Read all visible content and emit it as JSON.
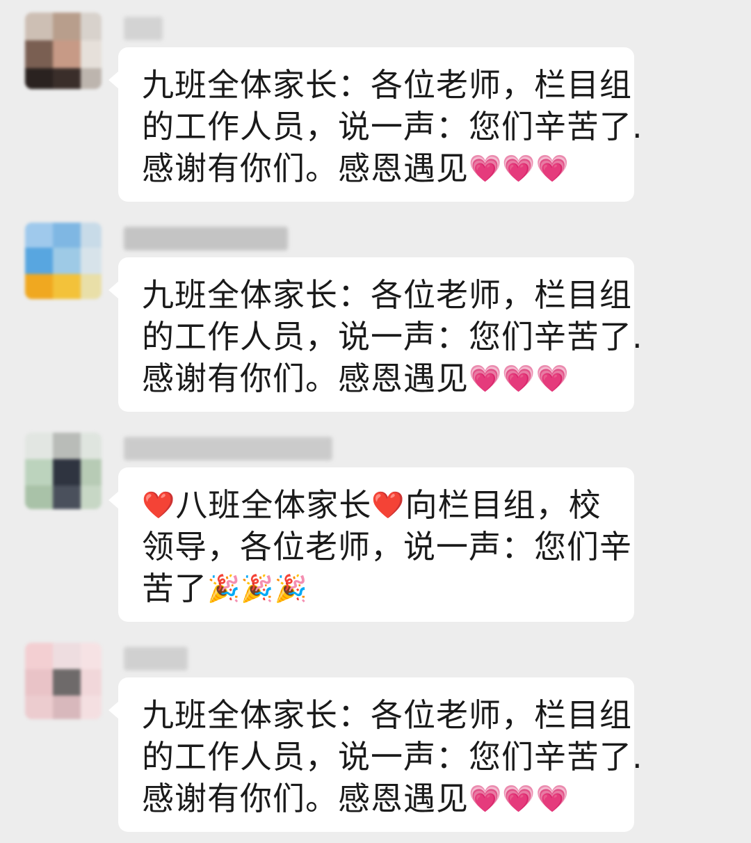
{
  "messages": [
    {
      "sender": "",
      "lines": [
        "九班全体家长：各位老师，栏目组",
        "的工作人员，说一声：您们辛苦了.",
        "感谢有你们。感恩遇见"
      ],
      "trailing_emoji": "💗💗💗"
    },
    {
      "sender": "",
      "lines": [
        "九班全体家长：各位老师，栏目组",
        "的工作人员，说一声：您们辛苦了.",
        "感谢有你们。感恩遇见"
      ],
      "trailing_emoji": "💗💗💗"
    },
    {
      "sender": "",
      "line1": {
        "e1": "❤️",
        "t1": "八班全体家长",
        "e2": "❤️",
        "t2": "向栏目组，校"
      },
      "lines": [
        "领导，各位老师，说一声：您们辛",
        "苦了"
      ],
      "trailing_emoji": "🎉🎉🎉"
    },
    {
      "sender": "",
      "lines": [
        "九班全体家长：各位老师，栏目组",
        "的工作人员，说一声：您们辛苦了.",
        "感谢有你们。感恩遇见"
      ],
      "trailing_emoji": "💗💗💗"
    }
  ],
  "colors": {
    "background": "#ededed",
    "bubble": "#ffffff",
    "text": "#1a1a1a"
  },
  "icons": {
    "pink_heart": "sparkling-heart",
    "red_heart": "red-heart",
    "party_popper": "party-popper"
  }
}
